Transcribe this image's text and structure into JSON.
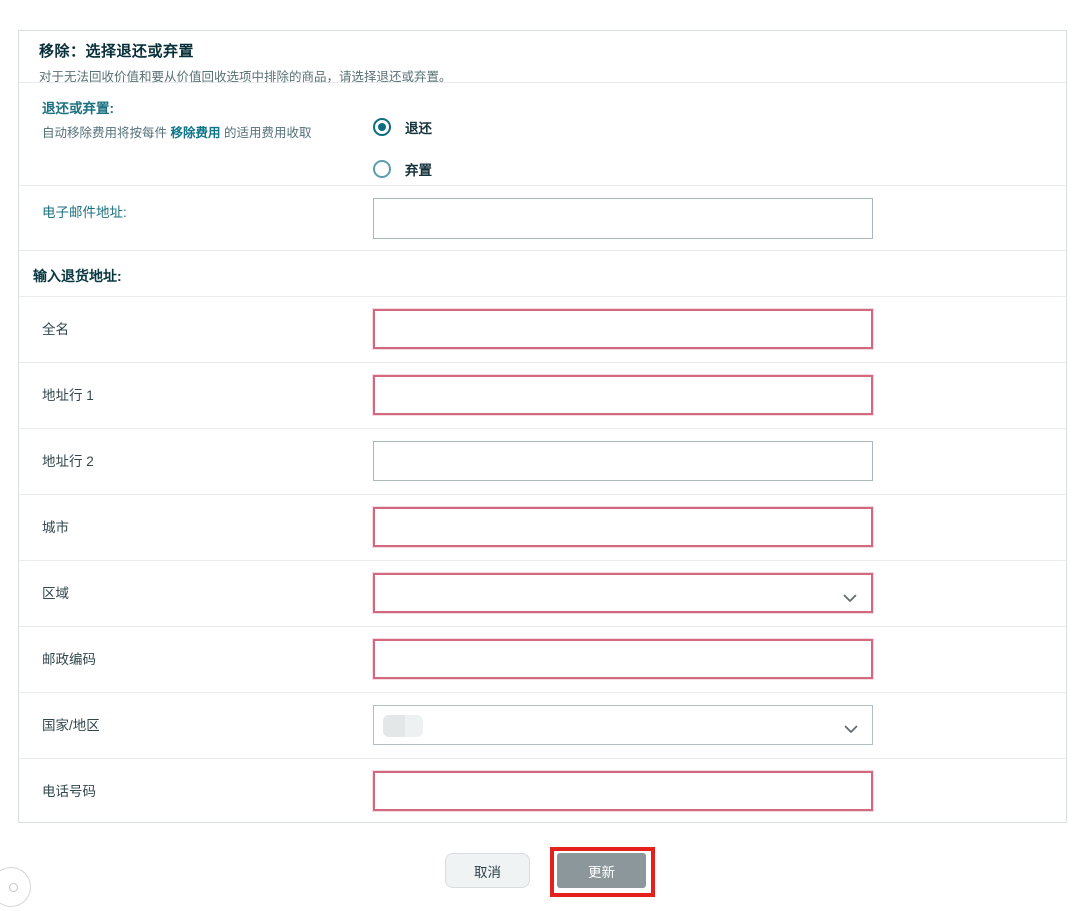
{
  "panel": {
    "title": "移除：选择退还或弃置",
    "subtitle": "对于无法回收价值和要从价值回收选项中排除的商品，请选择退还或弃置。",
    "return_or_dispose": {
      "label": "退还或弃置:",
      "note_prefix": "自动移除费用将按每件 ",
      "note_link": "移除费用",
      "note_suffix": " 的适用费用收取",
      "options": [
        {
          "label": "退还",
          "selected": true
        },
        {
          "label": "弃置",
          "selected": false
        }
      ]
    },
    "email": {
      "label": "电子邮件地址:",
      "value": "",
      "error": false
    },
    "address_section_title": "输入退货地址:",
    "fields": [
      {
        "label": "全名",
        "type": "text",
        "value": "",
        "error": true
      },
      {
        "label": "地址行 1",
        "type": "text",
        "value": "",
        "error": true
      },
      {
        "label": "地址行 2",
        "type": "text",
        "value": "",
        "error": false
      },
      {
        "label": "城市",
        "type": "text",
        "value": "",
        "error": true
      },
      {
        "label": "区域",
        "type": "select",
        "value": "",
        "error": true
      },
      {
        "label": "邮政编码",
        "type": "text",
        "value": "",
        "error": true
      },
      {
        "label": "国家/地区",
        "type": "select",
        "value": "",
        "error": false,
        "redacted": true
      },
      {
        "label": "电话号码",
        "type": "text",
        "value": "",
        "error": true
      }
    ]
  },
  "footer": {
    "cancel_label": "取消",
    "update_label": "更新"
  },
  "icons": {
    "chevron_down": "⌄",
    "radio_selected": "◉",
    "radio_unselected": "○"
  },
  "colors": {
    "teal_label": "#1d7280",
    "link_teal": "#0f7689",
    "error_border": "#d2697e",
    "annotation_red": "#e4211c",
    "update_button_gray": "#8b979a",
    "divider": "#e9eded"
  }
}
